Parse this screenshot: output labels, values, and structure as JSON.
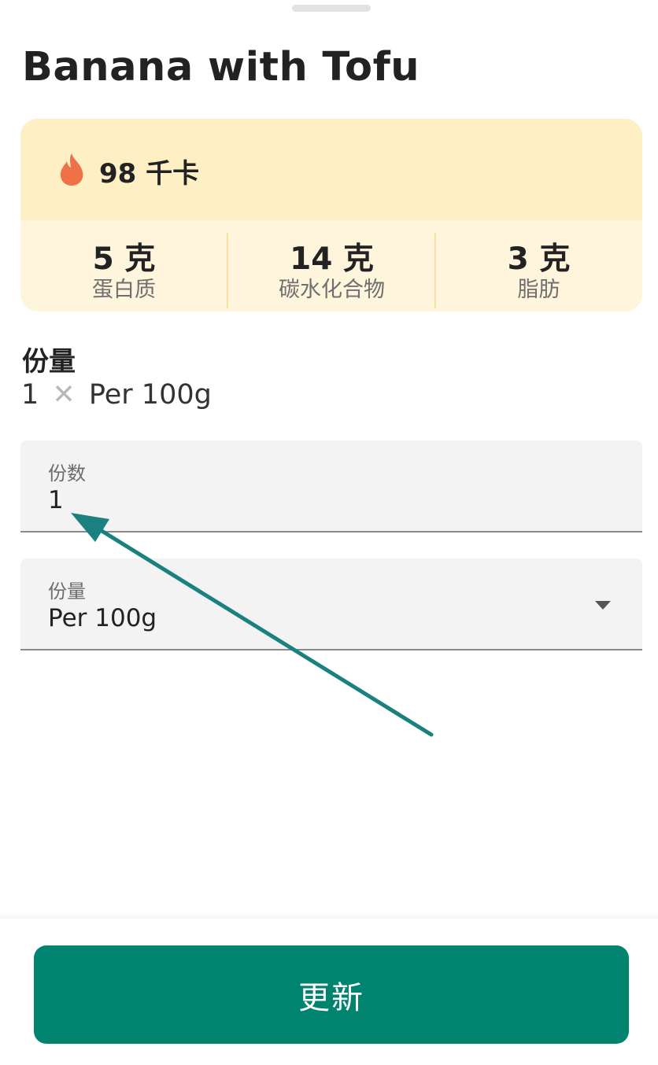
{
  "food": {
    "title": "Banana with Tofu"
  },
  "nutrition": {
    "calories": "98 千卡",
    "macros": [
      {
        "value": "5 克",
        "label": "蛋白质"
      },
      {
        "value": "14 克",
        "label": "碳水化合物"
      },
      {
        "value": "3 克",
        "label": "脂肪"
      }
    ]
  },
  "serving": {
    "heading": "份量",
    "quantity": "1",
    "times": "✕",
    "unit": "Per 100g"
  },
  "fields": {
    "servings_label": "份数",
    "servings_value": "1",
    "unit_label": "份量",
    "unit_value": "Per 100g"
  },
  "actions": {
    "update_label": "更新"
  },
  "colors": {
    "primary": "#00836f",
    "calorie_bg": "#ffefc4",
    "macro_bg": "#fff5dc",
    "flame": "#ee7148",
    "annotation_arrow": "#1b8080"
  }
}
